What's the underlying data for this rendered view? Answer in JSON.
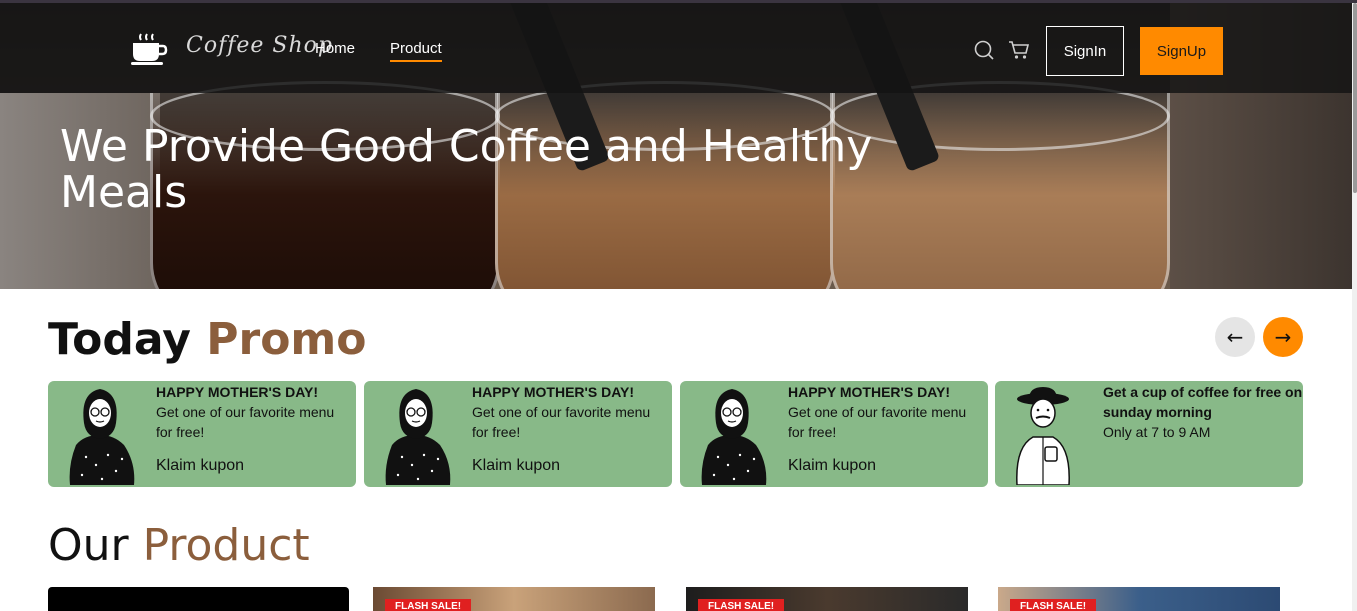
{
  "brand": {
    "name": "Coffee Shop"
  },
  "nav": {
    "home": "Home",
    "product": "Product"
  },
  "auth": {
    "signin": "SignIn",
    "signup": "SignUp"
  },
  "hero": {
    "title": "We Provide Good Coffee and Healthy Meals"
  },
  "promo": {
    "title_plain": "Today",
    "title_accent": "Promo",
    "prev_arrow": "←",
    "next_arrow": "→",
    "cards": [
      {
        "title": "HAPPY MOTHER'S DAY!",
        "desc": "Get one of our favorite menu for free!",
        "cta": "Klaim kupon"
      },
      {
        "title": "HAPPY MOTHER'S DAY!",
        "desc": "Get one of our favorite menu for free!",
        "cta": "Klaim kupon"
      },
      {
        "title": "HAPPY MOTHER'S DAY!",
        "desc": "Get one of our favorite menu for free!",
        "cta": "Klaim kupon"
      },
      {
        "title": "Get a cup of coffee for free on sunday morning",
        "desc": "Only at 7 to 9 AM"
      }
    ]
  },
  "products": {
    "title_plain": "Our",
    "title_accent": "Product",
    "badge": "FLASH SALE!"
  },
  "colors": {
    "accent": "#ff8a00",
    "brown": "#8b5e3c",
    "promo_green": "#88b988"
  },
  "icons": [
    "coffee-cup-icon",
    "search-icon",
    "cart-icon"
  ]
}
